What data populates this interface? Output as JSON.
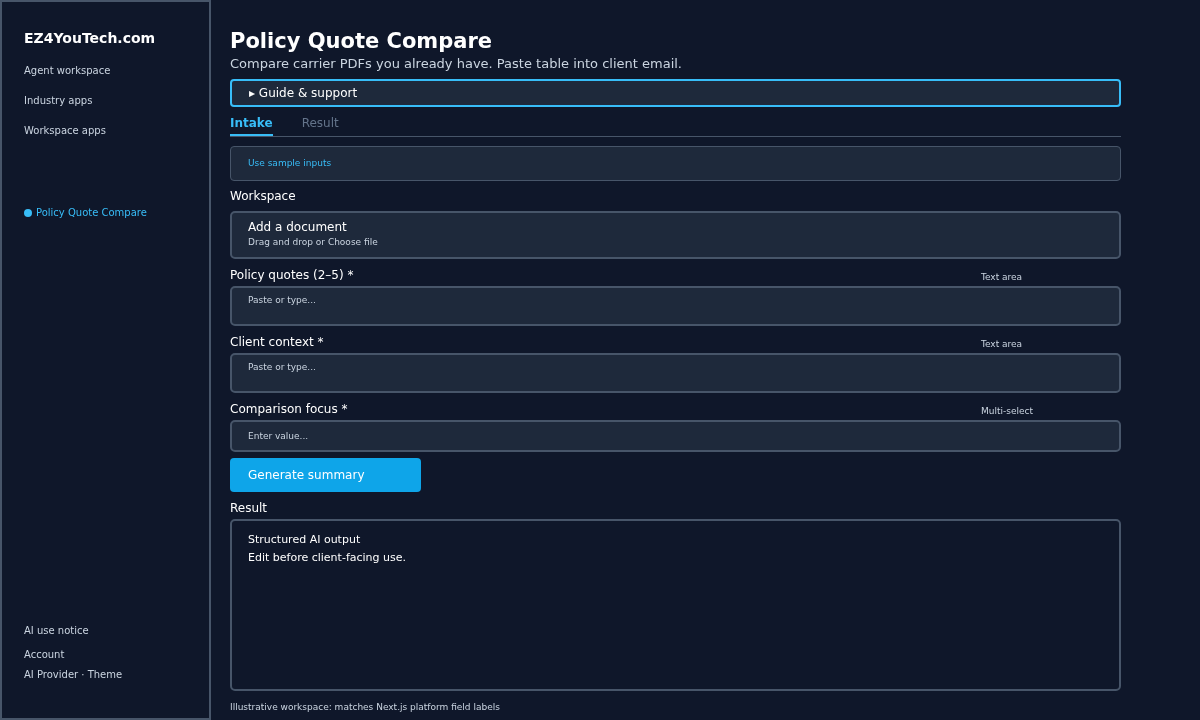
{
  "sidebar": {
    "brand": "EZ4YouTech.com",
    "nav": [
      {
        "label": "Agent workspace"
      },
      {
        "label": "Industry apps"
      },
      {
        "label": "Workspace apps"
      }
    ],
    "current": {
      "label": "Policy Quote Compare",
      "color": "#38bdf8"
    },
    "footer": [
      {
        "label": "AI use notice"
      },
      {
        "label": "Account"
      },
      {
        "label": "AI Provider · Theme"
      }
    ]
  },
  "page": {
    "title": "Policy Quote Compare",
    "subtitle": "Compare carrier PDFs you already have. Paste table into client email."
  },
  "guide": {
    "label": "▸ Guide & support",
    "expanded": false
  },
  "tabs": [
    {
      "label": "Intake",
      "selected": true
    },
    {
      "label": "Result",
      "selected": false
    }
  ],
  "sample_button": "Use sample inputs",
  "workspace": {
    "label": "Workspace",
    "title": "Add a document",
    "hint": "Drag and drop or Choose file"
  },
  "fields": [
    {
      "kind": "textarea",
      "label": "Policy quotes (2–5) *",
      "type_label": "Text area",
      "placeholder": "Paste or type..."
    },
    {
      "kind": "textarea",
      "label": "Client context *",
      "type_label": "Text area",
      "placeholder": "Paste or type..."
    },
    {
      "kind": "input",
      "label": "Comparison focus *",
      "type_label": "Multi-select",
      "placeholder": "Enter value..."
    }
  ],
  "generate_button": "Generate summary",
  "result": {
    "label": "Result",
    "lines": [
      "Structured AI output",
      "Edit before client-facing use."
    ]
  },
  "footnote": "Illustrative workspace: matches Next.js platform field labels"
}
